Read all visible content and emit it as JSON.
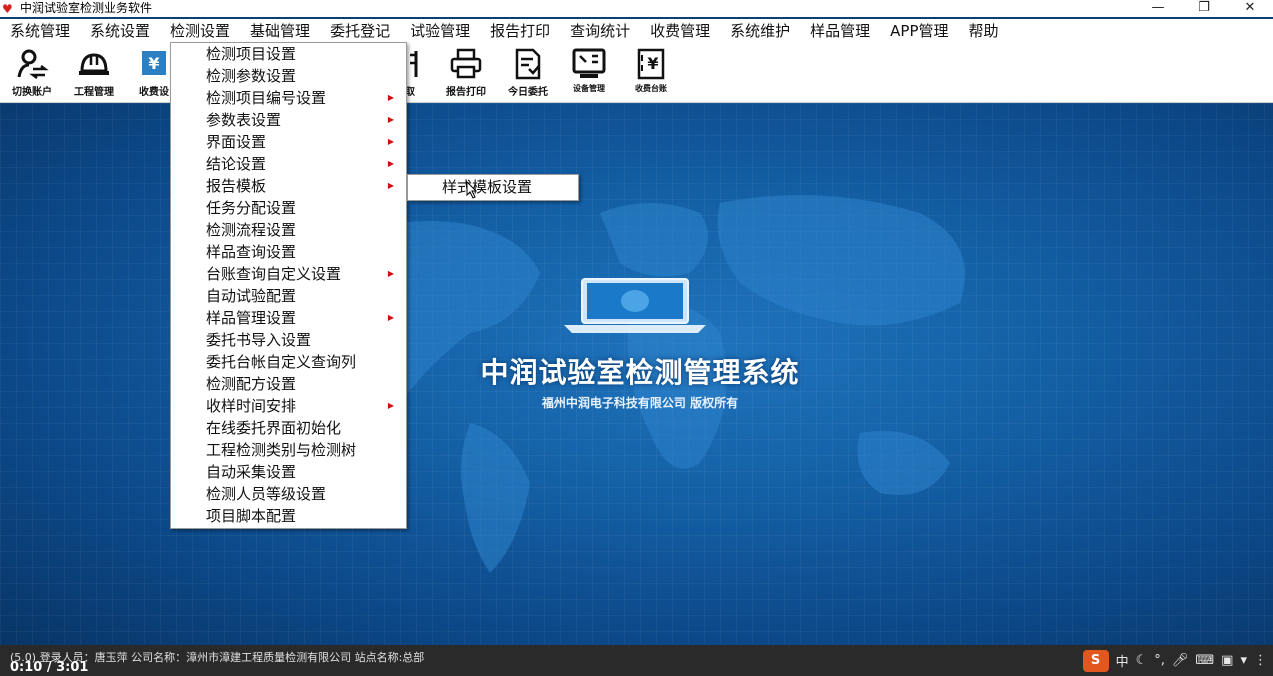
{
  "window": {
    "title": "中润试验室检测业务软件",
    "icon": "heart-icon",
    "buttons": [
      "—",
      "❐",
      "✕"
    ]
  },
  "menubar": {
    "items": [
      "系统管理",
      "系统设置",
      "检测设置",
      "基础管理",
      "委托登记",
      "试验管理",
      "报告打印",
      "查询统计",
      "收费管理",
      "系统维护",
      "样品管理",
      "APP管理",
      "帮助"
    ]
  },
  "toolbar": {
    "buttons": [
      {
        "label": "切换账户",
        "icon": "user-switch-icon"
      },
      {
        "label": "工程管理",
        "icon": "hardhat-icon"
      },
      {
        "label": "收费设置",
        "icon": "yen-card-icon"
      },
      {
        "label": "预取",
        "icon": "document-icon"
      },
      {
        "label": "报告打印",
        "icon": "printer-icon"
      },
      {
        "label": "今日委托",
        "icon": "clipboard-icon"
      },
      {
        "label": "设备管理",
        "icon": "monitor-tool-icon"
      },
      {
        "label": "收费台账",
        "icon": "yen-ledger-icon"
      }
    ],
    "partial_labels": {
      "fee_setting": "收费设",
      "prefetch": "预取"
    }
  },
  "dropdown": {
    "items": [
      {
        "label": "检测项目设置",
        "submenu": false
      },
      {
        "label": "检测参数设置",
        "submenu": false
      },
      {
        "label": "检测项目编号设置",
        "submenu": true
      },
      {
        "label": "参数表设置",
        "submenu": true
      },
      {
        "label": "界面设置",
        "submenu": true
      },
      {
        "label": "结论设置",
        "submenu": true
      },
      {
        "label": "报告模板",
        "submenu": true
      },
      {
        "label": "任务分配设置",
        "submenu": false
      },
      {
        "label": "检测流程设置",
        "submenu": false
      },
      {
        "label": "样品查询设置",
        "submenu": false
      },
      {
        "label": "台账查询自定义设置",
        "submenu": true
      },
      {
        "label": "自动试验配置",
        "submenu": false
      },
      {
        "label": "样品管理设置",
        "submenu": true
      },
      {
        "label": "委托书导入设置",
        "submenu": false
      },
      {
        "label": "委托台帐自定义查询列",
        "submenu": false
      },
      {
        "label": "检测配方设置",
        "submenu": false
      },
      {
        "label": "收样时间安排",
        "submenu": true
      },
      {
        "label": "在线委托界面初始化",
        "submenu": false
      },
      {
        "label": "工程检测类别与检测树",
        "submenu": false
      },
      {
        "label": "自动采集设置",
        "submenu": false
      },
      {
        "label": "检测人员等级设置",
        "submenu": false
      },
      {
        "label": "项目脚本配置",
        "submenu": false
      }
    ],
    "submenu_report_template": {
      "label": "样式模板设置"
    }
  },
  "splash": {
    "title": "中润试验室检测管理系统",
    "subtitle": "福州中润电子科技有限公司 版权所有"
  },
  "statusbar": {
    "text": "(5.0)  登录人员：唐玉萍                    公司名称：漳州市漳建工程质量检测有限公司    站点名称:总部",
    "player_time": "0:10 / 3:01"
  },
  "ime": {
    "logo": "S",
    "mode": "中",
    "icons": [
      "moon-icon",
      "punct-icon",
      "mic-icon",
      "keyboard-icon",
      "toolbox-icon",
      "shirt-icon",
      "grid-icon"
    ]
  },
  "colors": {
    "background_blue": "#1460a6",
    "submenu_arrow": "#d01010",
    "ime_logo": "#e2571e"
  }
}
